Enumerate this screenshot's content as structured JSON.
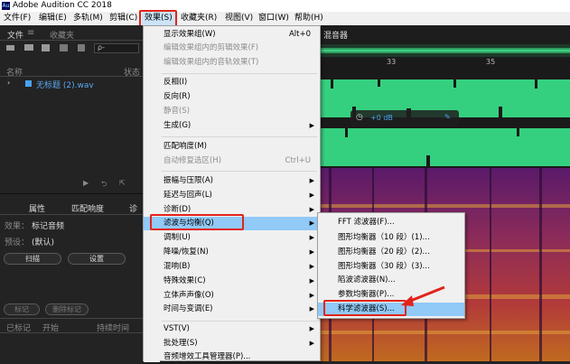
{
  "window": {
    "title": "Adobe Audition CC 2018",
    "app_icon": "Au"
  },
  "menubar": {
    "items": [
      {
        "label": "文件(F)"
      },
      {
        "label": "编辑(E)"
      },
      {
        "label": "多轨(M)"
      },
      {
        "label": "剪辑(C)"
      },
      {
        "label": "效果(S)"
      },
      {
        "label": "收藏夹(R)"
      },
      {
        "label": "视图(V)"
      },
      {
        "label": "窗口(W)"
      },
      {
        "label": "帮助(H)"
      }
    ]
  },
  "files_panel": {
    "tab_file": "文件",
    "tab_favorites": "收藏夹",
    "search_placeholder": "ρ-",
    "col_name": "名称",
    "col_status": "状态",
    "file_name": "无标题 (2).wav"
  },
  "effects_panel": {
    "tabs": [
      "属性",
      "匹配响度",
      "诊"
    ],
    "effect_label": "效果：",
    "effect_value": "标记音频",
    "preset_label": "预设：",
    "preset_value": "(默认)",
    "scan_button": "扫描",
    "settings_button": "设置",
    "marker_button": "标记",
    "delete_marker_button": "删除标记",
    "col_marked": "已标记",
    "col_start": "开始",
    "col_duration": "持续时间"
  },
  "editor": {
    "tab_label": "混音器",
    "ruler_ticks": [
      "33",
      "35"
    ],
    "hud_gain": "+0 dB"
  },
  "effects_menu": {
    "items": [
      {
        "label": "显示效果组(W)",
        "shortcut": "Alt+0",
        "disabled": false
      },
      {
        "label": "编辑效果组内的剪辑效果(F)",
        "disabled": true
      },
      {
        "label": "编辑效果组内的音轨效果(T)",
        "disabled": true
      },
      {
        "sep": true
      },
      {
        "label": "反相(I)",
        "disabled": false
      },
      {
        "label": "反向(R)",
        "disabled": false
      },
      {
        "label": "静音(S)",
        "disabled": true
      },
      {
        "label": "生成(G)",
        "submenu": true
      },
      {
        "sep": true
      },
      {
        "label": "匹配响度(M)",
        "disabled": false
      },
      {
        "label": "自动修复选区(H)",
        "shortcut": "Ctrl+U",
        "disabled": true
      },
      {
        "sep": true
      },
      {
        "label": "振幅与压限(A)",
        "submenu": true
      },
      {
        "label": "延迟与回声(L)",
        "submenu": true
      },
      {
        "label": "诊断(D)",
        "submenu": true
      },
      {
        "label": "滤波与均衡(Q)",
        "submenu": true,
        "highlighted": true
      },
      {
        "label": "调制(U)",
        "submenu": true
      },
      {
        "label": "降噪/恢复(N)",
        "submenu": true
      },
      {
        "label": "混响(B)",
        "submenu": true
      },
      {
        "label": "特殊效果(C)",
        "submenu": true
      },
      {
        "label": "立体声声像(O)",
        "submenu": true
      },
      {
        "label": "时间与变调(E)",
        "submenu": true
      },
      {
        "sep": true
      },
      {
        "label": "VST(V)",
        "submenu": true
      },
      {
        "label": "批处理(S)",
        "submenu": true
      },
      {
        "label": "音频增效工具管理器(P)..."
      }
    ]
  },
  "filter_submenu": {
    "items": [
      {
        "label": "FFT 滤波器(F)..."
      },
      {
        "label": "图形均衡器（10 段）(1)..."
      },
      {
        "label": "图形均衡器（20 段）(2)..."
      },
      {
        "label": "图形均衡器（30 段）(3)..."
      },
      {
        "label": "陷波滤波器(N)..."
      },
      {
        "label": "参数均衡器(P)..."
      },
      {
        "label": "科学滤波器(S)...",
        "highlighted": true
      }
    ]
  },
  "colors": {
    "accent_red": "#e2231a",
    "waveform_green": "#35d07f",
    "menu_highlight": "#91c9f7"
  }
}
